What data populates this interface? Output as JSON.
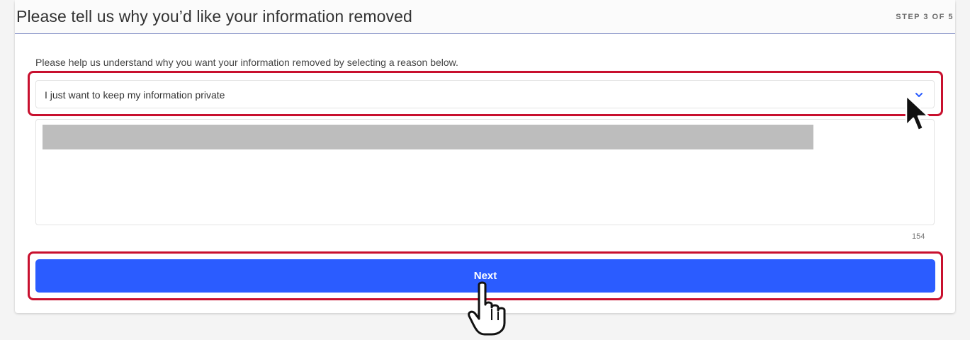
{
  "header": {
    "title": "Please tell us why you’d like your information removed",
    "step": "STEP 3 OF 5"
  },
  "form": {
    "instructions": "Please help us understand why you want your information removed by selecting a reason below.",
    "reason_select": {
      "selected": "I just want to keep my information private",
      "icon": "chevron-down-icon"
    },
    "details": {
      "counter": "154"
    },
    "next_label": "Next"
  },
  "colors": {
    "accent": "#2b5cff",
    "highlight": "#c8102e"
  }
}
